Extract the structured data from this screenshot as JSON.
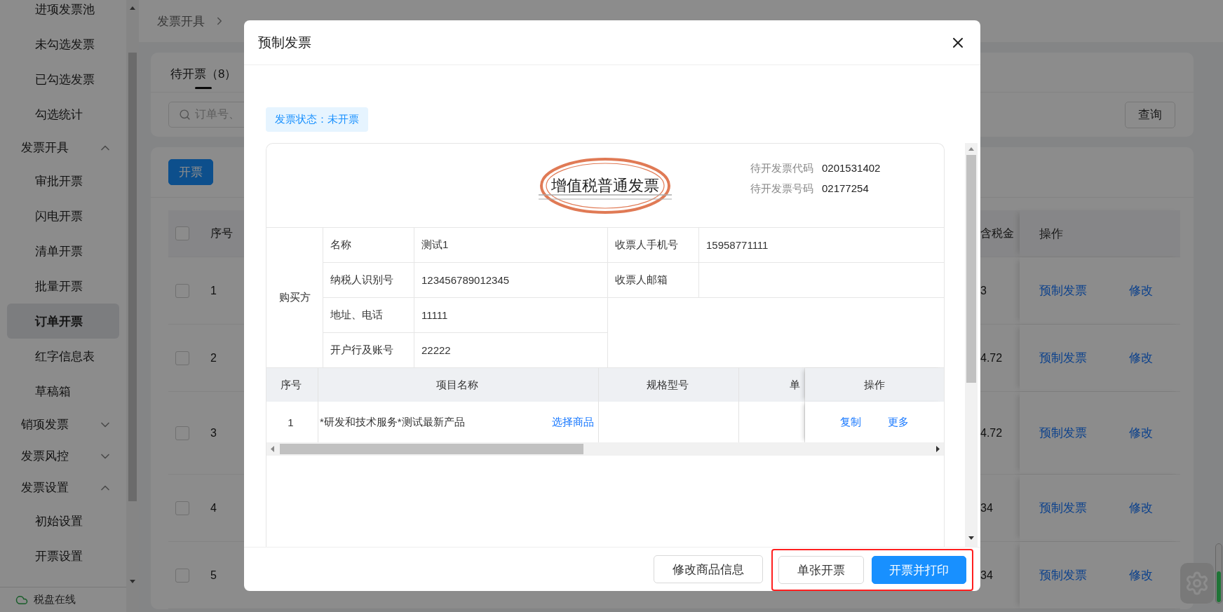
{
  "sidebar": {
    "items": [
      {
        "kind": "item",
        "label": "进项发票池",
        "selected": false
      },
      {
        "kind": "item",
        "label": "未勾选发票",
        "selected": false
      },
      {
        "kind": "item",
        "label": "已勾选发票",
        "selected": false
      },
      {
        "kind": "item",
        "label": "勾选统计",
        "selected": false
      },
      {
        "kind": "group",
        "label": "发票开具",
        "expanded": true,
        "children": [
          {
            "kind": "item",
            "label": "审批开票",
            "selected": false
          },
          {
            "kind": "item",
            "label": "闪电开票",
            "selected": false
          },
          {
            "kind": "item",
            "label": "清单开票",
            "selected": false
          },
          {
            "kind": "item",
            "label": "批量开票",
            "selected": false
          },
          {
            "kind": "item",
            "label": "订单开票",
            "selected": true
          },
          {
            "kind": "item",
            "label": "红字信息表",
            "selected": false
          },
          {
            "kind": "item",
            "label": "草稿箱",
            "selected": false
          }
        ]
      },
      {
        "kind": "group",
        "label": "销项发票",
        "expanded": false
      },
      {
        "kind": "group",
        "label": "发票风控",
        "expanded": false
      },
      {
        "kind": "group",
        "label": "发票设置",
        "expanded": true,
        "children": [
          {
            "kind": "item",
            "label": "初始设置",
            "selected": false
          },
          {
            "kind": "item",
            "label": "开票设置",
            "selected": false
          }
        ]
      }
    ],
    "footer": "税盘在线"
  },
  "breadcrumb": [
    "发票开具"
  ],
  "tabs": [
    {
      "label": "待开票（8）",
      "selected": true
    }
  ],
  "search": {
    "placeholder": "订单号、"
  },
  "query_button": "查询",
  "issue_button": "开票",
  "table": {
    "header_checked": false,
    "columns": [
      "序号",
      "含税金",
      "操作"
    ],
    "rows": [
      {
        "index": "1",
        "amount": "3",
        "checked": false,
        "actions": [
          "预制发票",
          "修改"
        ]
      },
      {
        "index": "2",
        "amount": "4.72",
        "checked": false,
        "actions": [
          "预制发票",
          "修改"
        ]
      },
      {
        "index": "3",
        "amount": "4.72",
        "checked": false,
        "actions": [
          "预制发票",
          "修改"
        ]
      },
      {
        "index": "4",
        "amount": "34",
        "checked": false,
        "actions": [
          "预制发票",
          "修改"
        ]
      },
      {
        "index": "5",
        "amount": "34",
        "checked": false,
        "actions": [
          "预制发票",
          "修改"
        ]
      }
    ]
  },
  "modal": {
    "title": "预制发票",
    "status": "发票状态：未开票",
    "invoice_title": "增值税普通发票",
    "meta": [
      {
        "label": "待开发票代码",
        "value": "0201531402"
      },
      {
        "label": "待开发票号码",
        "value": "02177254"
      }
    ],
    "buyer": {
      "heading": "购买方",
      "fields": [
        {
          "label": "名称",
          "value": "测试1"
        },
        {
          "label": "纳税人识别号",
          "value": "123456789012345"
        },
        {
          "label": "地址、电话",
          "value": "11111"
        },
        {
          "label": "开户行及账号",
          "value": "22222"
        }
      ],
      "contacts": [
        {
          "label": "收票人手机号",
          "value": "15958771111"
        },
        {
          "label": "收票人邮箱"
        }
      ]
    },
    "goods": {
      "columns": [
        "序号",
        "项目名称",
        "规格型号",
        "单",
        "操作"
      ],
      "rows": [
        {
          "index": "1",
          "name": "*研发和技术服务*测试最新产品",
          "pick": "选择商品",
          "actions": [
            "复制",
            "更多"
          ]
        }
      ]
    },
    "buttons": [
      {
        "label": "修改商品信息",
        "kind": "default"
      }
    ],
    "framed_buttons": [
      {
        "label": "单张开票",
        "kind": "default"
      },
      {
        "label": "开票并打印",
        "kind": "primary"
      }
    ]
  }
}
